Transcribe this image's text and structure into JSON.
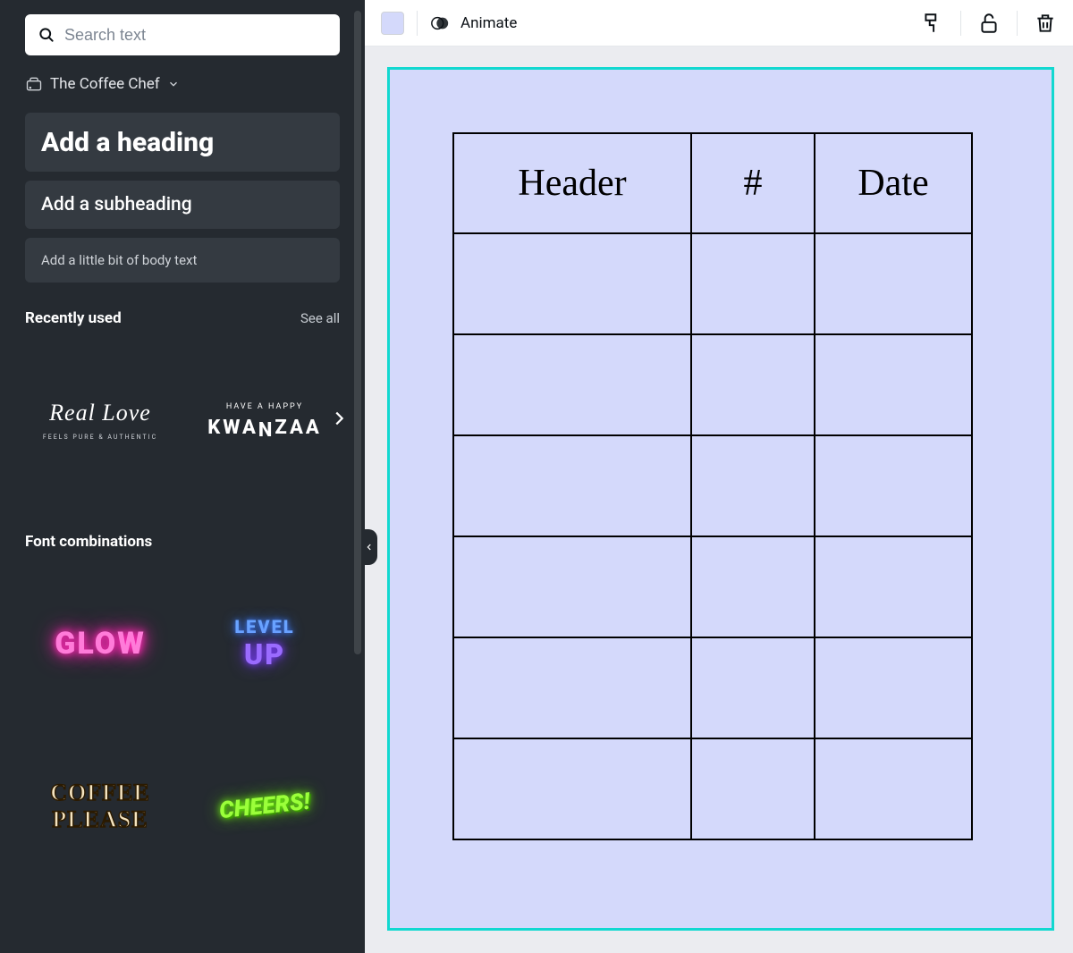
{
  "sidebar": {
    "search_placeholder": "Search text",
    "brand_kit_name": "The Coffee Chef",
    "add_heading": "Add a heading",
    "add_subheading": "Add a subheading",
    "add_body": "Add a little bit of body text",
    "recently_used": {
      "title": "Recently used",
      "see_all": "See all",
      "items": [
        {
          "line1": "Real Love",
          "line2": "FEELS PURE & AUTHENTIC"
        },
        {
          "line1": "HAVE A HAPPY",
          "line2": "KWANZAA"
        }
      ]
    },
    "font_combinations": {
      "title": "Font combinations",
      "items": [
        {
          "text": "GLOW"
        },
        {
          "line1": "LEVEL",
          "line2": "UP"
        },
        {
          "line1": "COFFEE",
          "line2": "PLEASE"
        },
        {
          "text": "CHEERS!"
        }
      ]
    }
  },
  "toolbar": {
    "animate": "Animate",
    "swatch_color": "#d4d9fb"
  },
  "canvas": {
    "table": {
      "headers": [
        "Header",
        "#",
        "Date"
      ],
      "body_rows": 6
    }
  }
}
